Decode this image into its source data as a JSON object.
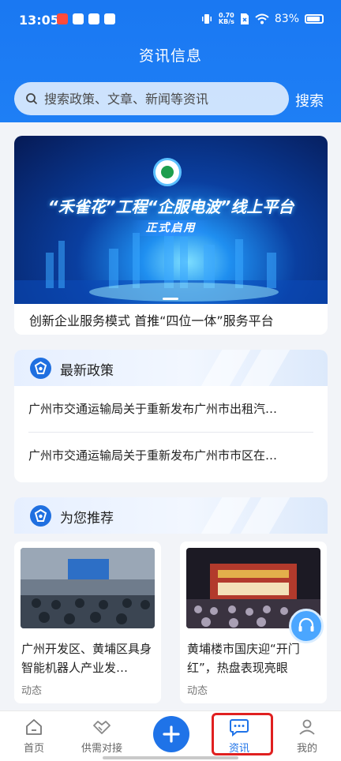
{
  "status_bar": {
    "time": "13:05",
    "net_speed_value": "0.70",
    "net_speed_unit": "KB/s",
    "battery": "83%"
  },
  "header": {
    "title": "资讯信息",
    "search_placeholder": "搜索政策、文章、新闻等资讯",
    "search_button": "搜索"
  },
  "banner": {
    "headline": "“禾雀花”工程“企服电波”线上平台",
    "subline": "正式启用",
    "caption": "创新企业服务模式 首推“四位一体”服务平台"
  },
  "latest_policy": {
    "title": "最新政策",
    "items": [
      "广州市交通运输局关于重新发布广州市出租汽…",
      "广州市交通运输局关于重新发布广州市市区在…"
    ]
  },
  "recommend": {
    "title": "为您推荐",
    "items": [
      {
        "title": "广州开发区、黄埔区具身智能机器人产业发…",
        "tag": "动态"
      },
      {
        "title": "黄埔楼市国庆迎“开门红”，热盘表现亮眼",
        "tag": "动态"
      }
    ]
  },
  "tabbar": {
    "items": [
      "首页",
      "供需对接",
      "资讯",
      "我的"
    ],
    "active": "资讯"
  },
  "colors": {
    "primary": "#1f73e8",
    "highlight": "#e02020"
  }
}
